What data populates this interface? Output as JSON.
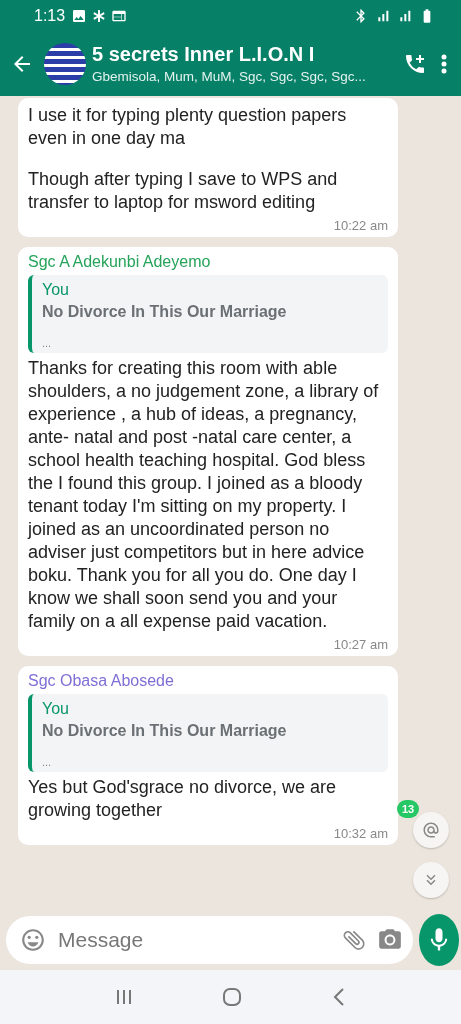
{
  "status_bar": {
    "time": "1:13"
  },
  "header": {
    "title": "5 secrets Inner L.I.O.N I",
    "subtitle": "Gbemisola, Mum, MuM, Sgc, Sgc, Sgc, Sgc..."
  },
  "messages": [
    {
      "paragraphs": [
        "I use it for typing plenty question papers even in one day ma",
        "Though after typing I save to WPS and transfer to laptop for msword editing"
      ],
      "time": "10:22 am"
    },
    {
      "sender": "Sgc A Adekunbi Adeyemo",
      "color": "#25a35a",
      "quote": {
        "author": "You",
        "text": "No Divorce In This Our Marriage",
        "more": "..."
      },
      "paragraphs": [
        "Thanks for creating this room with able shoulders, a no judgement zone, a library of experience , a hub of ideas, a pregnancy, ante- natal and post -natal care center, a school health teaching hospital. God bless the I found this group. I joined as a bloody tenant today I'm sitting on my property. I joined as an uncoordinated person no adviser just competitors but in here advice boku. Thank you for all you do. One day I know we shall soon send you and your family on a all expense paid vacation."
      ],
      "time": "10:27 am"
    },
    {
      "sender": "Sgc Obasa Abosede",
      "color": "#7e6fd6",
      "quote": {
        "author": "You",
        "text": "No Divorce In This Our Marriage",
        "more": "..."
      },
      "paragraphs": [
        "Yes but God'sgrace no divorce, we are growing together"
      ],
      "time": "10:32 am"
    }
  ],
  "mention_badge": {
    "count": "13"
  },
  "composer": {
    "placeholder": "Message"
  }
}
